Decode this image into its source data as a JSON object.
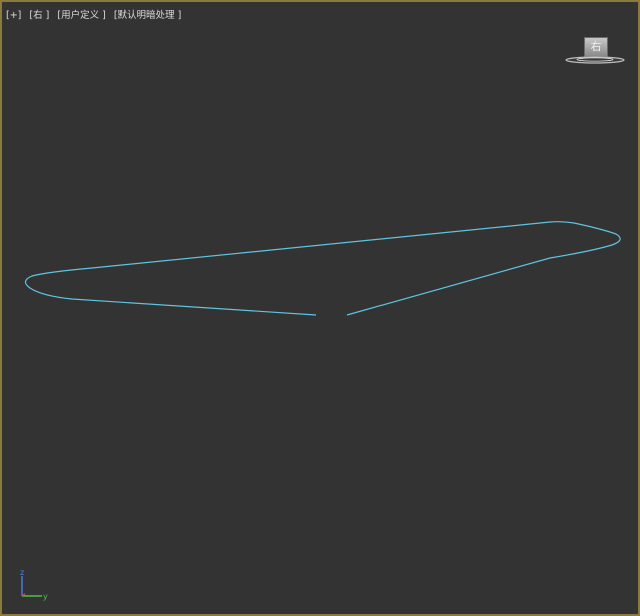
{
  "viewport": {
    "labels": [
      "[+]",
      "[右 ]",
      "[用户定义 ]",
      "[默认明暗处理 ]"
    ],
    "border_color": "#8c7a3a",
    "background_color": "#333333",
    "curve_color": "#5fc4e0"
  },
  "viewcube": {
    "face_label": "右"
  },
  "axis_gizmo": {
    "x_label": "",
    "y_label": "y",
    "z_label": "z",
    "y_color": "#4ec04e",
    "z_color": "#4d7fe0",
    "x_color": "#d84a3a"
  }
}
